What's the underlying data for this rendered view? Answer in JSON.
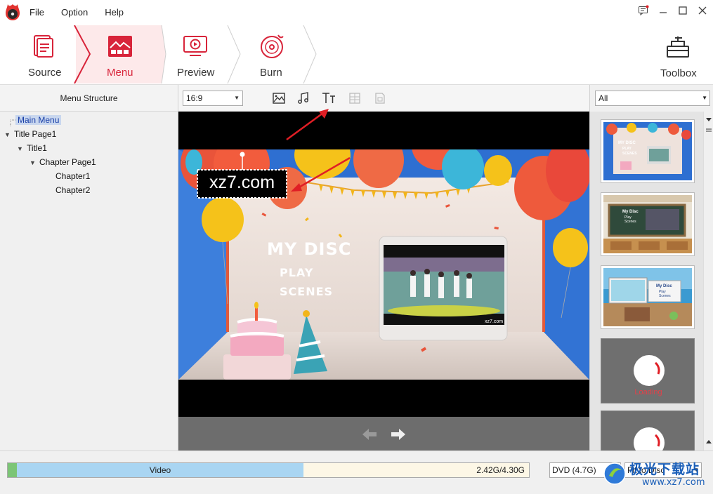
{
  "menu": {
    "file": "File",
    "option": "Option",
    "help": "Help"
  },
  "steps": {
    "source": "Source",
    "menu": "Menu",
    "preview": "Preview",
    "burn": "Burn",
    "toolbox": "Toolbox"
  },
  "left_panel": {
    "title": "Menu Structure",
    "tree": [
      {
        "label": "Main Menu",
        "selected": true
      },
      {
        "label": "Title Page1"
      },
      {
        "label": "Title1"
      },
      {
        "label": "Chapter Page1"
      },
      {
        "label": "Chapter1"
      },
      {
        "label": "Chapter2"
      }
    ]
  },
  "editor": {
    "aspect_ratio": "16:9",
    "overlay_text": "xz7.com",
    "menu_texts": {
      "title": "MY DISC",
      "play": "PLAY",
      "scenes": "SCENES"
    },
    "video_watermark": "xz7.com"
  },
  "right_panel": {
    "filter": "All",
    "templates": [
      {
        "title": "MY DISC",
        "play": "PLAY",
        "scenes": "SCENES"
      },
      {
        "title": "My Disc",
        "play": "Play",
        "scenes": "Scenes"
      },
      {
        "title": "My Disc",
        "play": "Play",
        "scenes": "Scenes"
      }
    ],
    "loading_label": "Loading"
  },
  "bottom": {
    "video_label": "Video",
    "size": "2.42G/4.30G",
    "used_fraction": 0.56,
    "disc_type": "DVD (4.7G)",
    "fit_mode": "Fit to Disc"
  },
  "watermark": {
    "cn": "极光下载站",
    "url": "www.xz7.com"
  },
  "colors": {
    "accent": "#d8243a",
    "arrow": "#e01e25",
    "menu_bg": "#fde9ea"
  }
}
